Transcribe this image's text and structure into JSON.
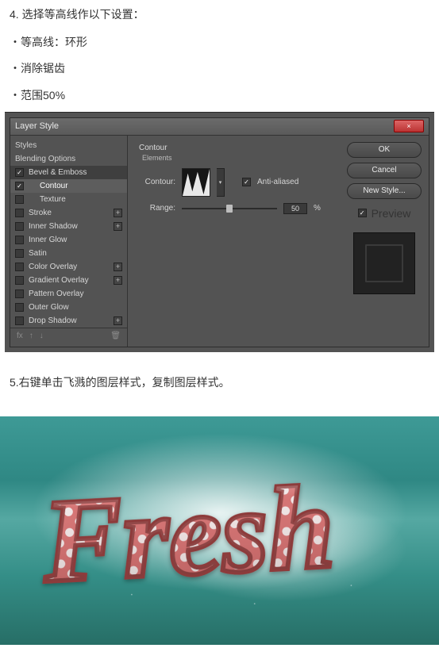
{
  "steps": {
    "s4_title": "4.  选择等高线作以下设置：",
    "s4_b1": "等高线：环形",
    "s4_b2": "消除锯齿",
    "s4_b3": "范围50%",
    "s5_title": "5.右键单击飞溅的图层样式，复制图层样式。"
  },
  "dialog": {
    "title": "Layer Style",
    "close": "×",
    "sidebar": {
      "styles": "Styles",
      "blending": "Blending Options",
      "bevel": "Bevel & Emboss",
      "contour": "Contour",
      "texture": "Texture",
      "stroke": "Stroke",
      "innerShadow": "Inner Shadow",
      "innerGlow": "Inner Glow",
      "satin": "Satin",
      "colorOverlay": "Color Overlay",
      "gradientOverlay": "Gradient Overlay",
      "patternOverlay": "Pattern Overlay",
      "outerGlow": "Outer Glow",
      "dropShadow": "Drop Shadow"
    },
    "center": {
      "groupTitle": "Contour",
      "groupSub": "Elements",
      "contourLabel": "Contour:",
      "antiAliased": "Anti-aliased",
      "rangeLabel": "Range:",
      "rangeValue": "50",
      "rangeUnit": "%"
    },
    "right": {
      "ok": "OK",
      "cancel": "Cancel",
      "newStyle": "New Style...",
      "preview": "Preview"
    },
    "footIcons": {
      "fx": "fx",
      "up": "↑",
      "down": "↓",
      "trash": "🗑"
    }
  },
  "fresh": {
    "text": "Fresh",
    "fill": "#d36a6a",
    "dot": "#f3eaea",
    "stroke": "#8d3b3b"
  }
}
